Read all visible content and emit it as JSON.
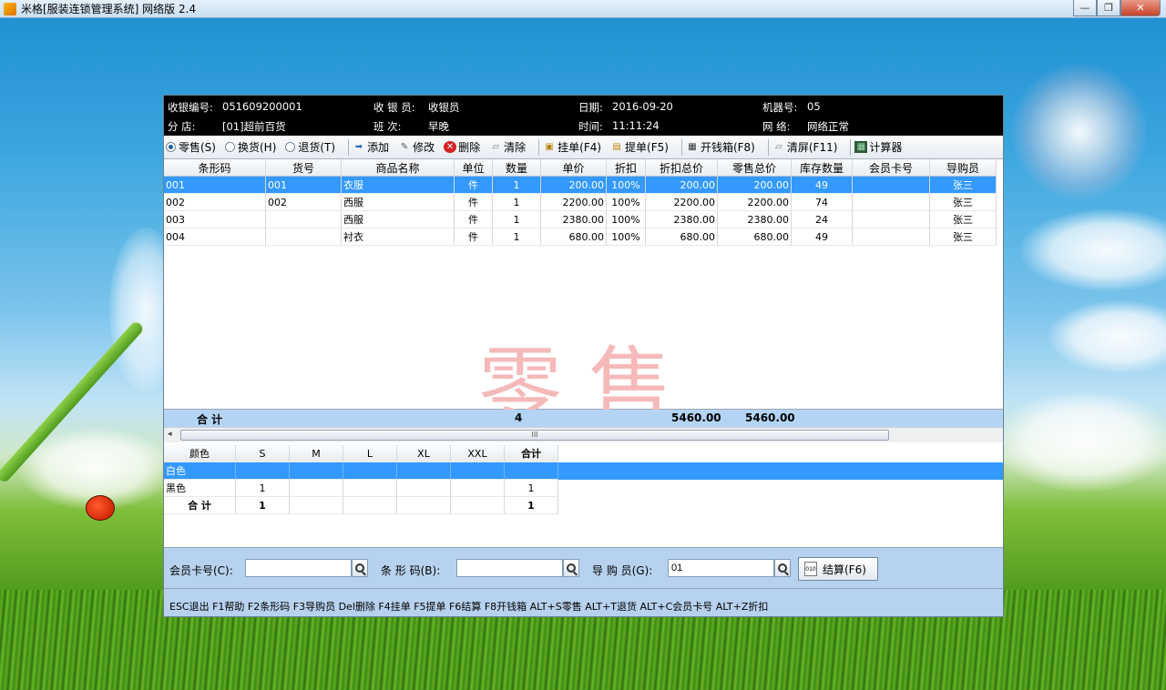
{
  "window": {
    "title": "米格[服装连锁管理系统] 网络版 2.4",
    "minimize_label": "—",
    "maximize_label": "❐",
    "close_label": "✕"
  },
  "info": {
    "receipt_label": "收银编号:",
    "receipt_value": "051609200001",
    "cashier_label": "收 银 员:",
    "cashier_value": "收银员",
    "date_label": "日期:",
    "date_value": "2016-09-20",
    "machine_label": "机器号:",
    "machine_value": "05",
    "store_label": "分    店:",
    "store_value": "[01]超前百货",
    "shift_label": "班    次:",
    "shift_value": "早晚",
    "time_label": "时间:",
    "time_value": "11:11:24",
    "network_label": "网  络:",
    "network_value": "网络正常"
  },
  "toolbar": {
    "radio_sale": "零售(S)",
    "radio_exchange": "换货(H)",
    "radio_return": "退货(T)",
    "add": "添加",
    "edit": "修改",
    "delete": "删除",
    "clear": "清除",
    "hold": "挂单(F4)",
    "recall": "提单(F5)",
    "drawer": "开钱箱(F8)",
    "clear_screen": "清屏(F11)",
    "calculator": "计算器"
  },
  "grid": {
    "columns": [
      "条形码",
      "货号",
      "商品名称",
      "单位",
      "数量",
      "单价",
      "折扣",
      "折扣总价",
      "零售总价",
      "库存数量",
      "会员卡号",
      "导购员"
    ],
    "rows": [
      [
        "001",
        "001",
        "衣服",
        "件",
        "1",
        "200.00",
        "100%",
        "200.00",
        "200.00",
        "49",
        "",
        "张三"
      ],
      [
        "002",
        "002",
        "西服",
        "件",
        "1",
        "2200.00",
        "100%",
        "2200.00",
        "2200.00",
        "74",
        "",
        "张三"
      ],
      [
        "003",
        "",
        "西服",
        "件",
        "1",
        "2380.00",
        "100%",
        "2380.00",
        "2380.00",
        "24",
        "",
        "张三"
      ],
      [
        "004",
        "",
        "衬衣",
        "件",
        "1",
        "680.00",
        "100%",
        "680.00",
        "680.00",
        "49",
        "",
        "张三"
      ]
    ],
    "watermark": "零    售",
    "total_label": "合  计",
    "total_qty": "4",
    "total_discount": "5460.00",
    "total_retail": "5460.00",
    "scroll_grip": "III",
    "scroll_left": "◂"
  },
  "size_grid": {
    "columns": [
      "颜色",
      "S",
      "M",
      "L",
      "XL",
      "XXL",
      "合计"
    ],
    "rows": [
      [
        "白色",
        "",
        "",
        "",
        "",
        "",
        ""
      ],
      [
        "黑色",
        "1",
        "",
        "",
        "",
        "",
        "1"
      ]
    ],
    "total": [
      "合  计",
      "1",
      "",
      "",
      "",
      "",
      "1"
    ]
  },
  "bottom": {
    "member_label": "会员卡号(C):",
    "member_value": "",
    "barcode_label": "条 形 码(B):",
    "barcode_value": "",
    "guide_label": "导 购 员(G):",
    "guide_value": "01",
    "pay_label": "结算(F6)",
    "pay_icon_text": "010",
    "shortcuts": "ESC退出 F1帮助 F2条形码 F3导购员 Del删除 F4挂单 F5提单 F6结算 F8开钱箱 ALT+S零售 ALT+T退货 ALT+C会员卡号  ALT+Z折扣"
  }
}
